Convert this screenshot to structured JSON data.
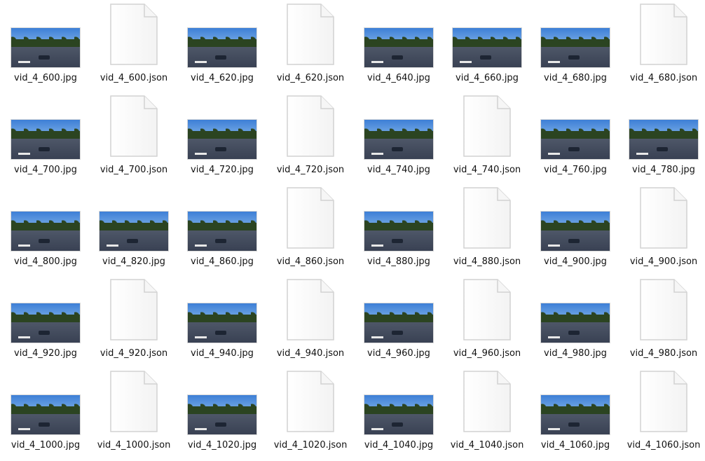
{
  "files": [
    {
      "name": "vid_4_600.jpg",
      "type": "jpg"
    },
    {
      "name": "vid_4_600.json",
      "type": "json"
    },
    {
      "name": "vid_4_620.jpg",
      "type": "jpg"
    },
    {
      "name": "vid_4_620.json",
      "type": "json"
    },
    {
      "name": "vid_4_640.jpg",
      "type": "jpg"
    },
    {
      "name": "vid_4_660.jpg",
      "type": "jpg"
    },
    {
      "name": "vid_4_680.jpg",
      "type": "jpg"
    },
    {
      "name": "vid_4_680.json",
      "type": "json"
    },
    {
      "name": "vid_4_700.jpg",
      "type": "jpg"
    },
    {
      "name": "vid_4_700.json",
      "type": "json"
    },
    {
      "name": "vid_4_720.jpg",
      "type": "jpg"
    },
    {
      "name": "vid_4_720.json",
      "type": "json"
    },
    {
      "name": "vid_4_740.jpg",
      "type": "jpg"
    },
    {
      "name": "vid_4_740.json",
      "type": "json"
    },
    {
      "name": "vid_4_760.jpg",
      "type": "jpg"
    },
    {
      "name": "vid_4_780.jpg",
      "type": "jpg"
    },
    {
      "name": "vid_4_800.jpg",
      "type": "jpg"
    },
    {
      "name": "vid_4_820.jpg",
      "type": "jpg"
    },
    {
      "name": "vid_4_860.jpg",
      "type": "jpg"
    },
    {
      "name": "vid_4_860.json",
      "type": "json"
    },
    {
      "name": "vid_4_880.jpg",
      "type": "jpg"
    },
    {
      "name": "vid_4_880.json",
      "type": "json"
    },
    {
      "name": "vid_4_900.jpg",
      "type": "jpg"
    },
    {
      "name": "vid_4_900.json",
      "type": "json"
    },
    {
      "name": "vid_4_920.jpg",
      "type": "jpg"
    },
    {
      "name": "vid_4_920.json",
      "type": "json"
    },
    {
      "name": "vid_4_940.jpg",
      "type": "jpg"
    },
    {
      "name": "vid_4_940.json",
      "type": "json"
    },
    {
      "name": "vid_4_960.jpg",
      "type": "jpg"
    },
    {
      "name": "vid_4_960.json",
      "type": "json"
    },
    {
      "name": "vid_4_980.jpg",
      "type": "jpg"
    },
    {
      "name": "vid_4_980.json",
      "type": "json"
    },
    {
      "name": "vid_4_1000.jpg",
      "type": "jpg"
    },
    {
      "name": "vid_4_1000.json",
      "type": "json"
    },
    {
      "name": "vid_4_1020.jpg",
      "type": "jpg"
    },
    {
      "name": "vid_4_1020.json",
      "type": "json"
    },
    {
      "name": "vid_4_1040.jpg",
      "type": "jpg"
    },
    {
      "name": "vid_4_1040.json",
      "type": "json"
    },
    {
      "name": "vid_4_1060.jpg",
      "type": "jpg"
    },
    {
      "name": "vid_4_1060.json",
      "type": "json"
    }
  ],
  "icons": {
    "jpg": "image-thumbnail",
    "json": "document-icon"
  },
  "colors": {
    "background": "#ffffff",
    "sky": "#3d7fd6",
    "road": "#4e5768",
    "trees": "#2b4421"
  }
}
